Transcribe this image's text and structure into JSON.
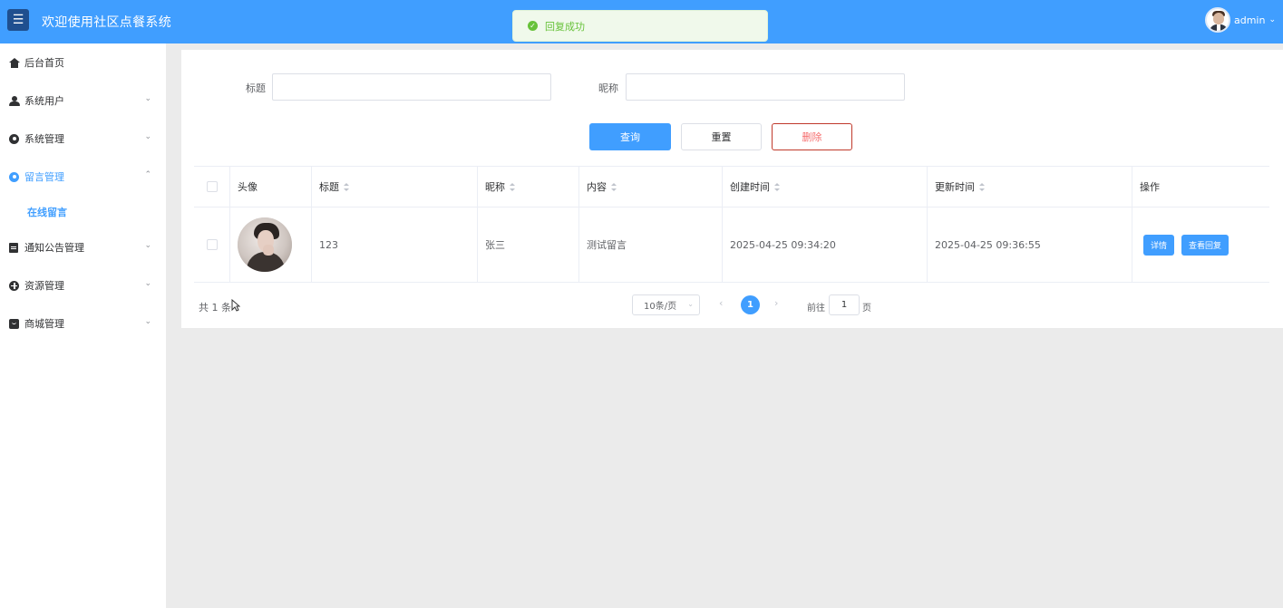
{
  "header": {
    "menu_icon": "☰",
    "title": "欢迎使用社区点餐系统",
    "username": "admin",
    "caret": "⌄"
  },
  "toast": {
    "icon": "✓",
    "message": "回复成功"
  },
  "sidebar": {
    "items": [
      {
        "label": "后台首页",
        "icon": "home-icon"
      },
      {
        "label": "系统用户",
        "icon": "user-icon",
        "arrow": "⌄"
      },
      {
        "label": "系统管理",
        "icon": "gear-icon",
        "arrow": "⌄"
      },
      {
        "label": "留言管理",
        "icon": "gear-icon",
        "arrow": "⌃",
        "active": true
      },
      {
        "label": "通知公告管理",
        "icon": "document-icon",
        "arrow": "⌄"
      },
      {
        "label": "资源管理",
        "icon": "plus-circle-icon",
        "arrow": "⌄"
      },
      {
        "label": "商城管理",
        "icon": "shop-icon",
        "arrow": "⌄"
      }
    ],
    "sub_item": "在线留言"
  },
  "search": {
    "title_label": "标题",
    "title_value": "",
    "nickname_label": "昵称",
    "nickname_value": "",
    "query_button": "查询",
    "reset_button": "重置",
    "delete_button": "删除"
  },
  "table": {
    "headers": {
      "avatar": "头像",
      "title": "标题",
      "nickname": "昵称",
      "content": "内容",
      "created": "创建时间",
      "updated": "更新时间",
      "actions": "操作"
    },
    "rows": [
      {
        "title": "123",
        "nickname": "张三",
        "content": "测试留言",
        "created": "2025-04-25 09:34:20",
        "updated": "2025-04-25 09:36:55",
        "detail_button": "详情",
        "reply_button": "查看回复"
      }
    ]
  },
  "pagination": {
    "total": "共 1 条",
    "page_size": "10条/页",
    "prev": "‹",
    "current": "1",
    "next": "›",
    "goto_label": "前往",
    "goto_value": "1",
    "page_suffix": "页"
  },
  "colors": {
    "primary": "#409eff",
    "success": "#67c23a",
    "danger": "#f56c6c"
  }
}
